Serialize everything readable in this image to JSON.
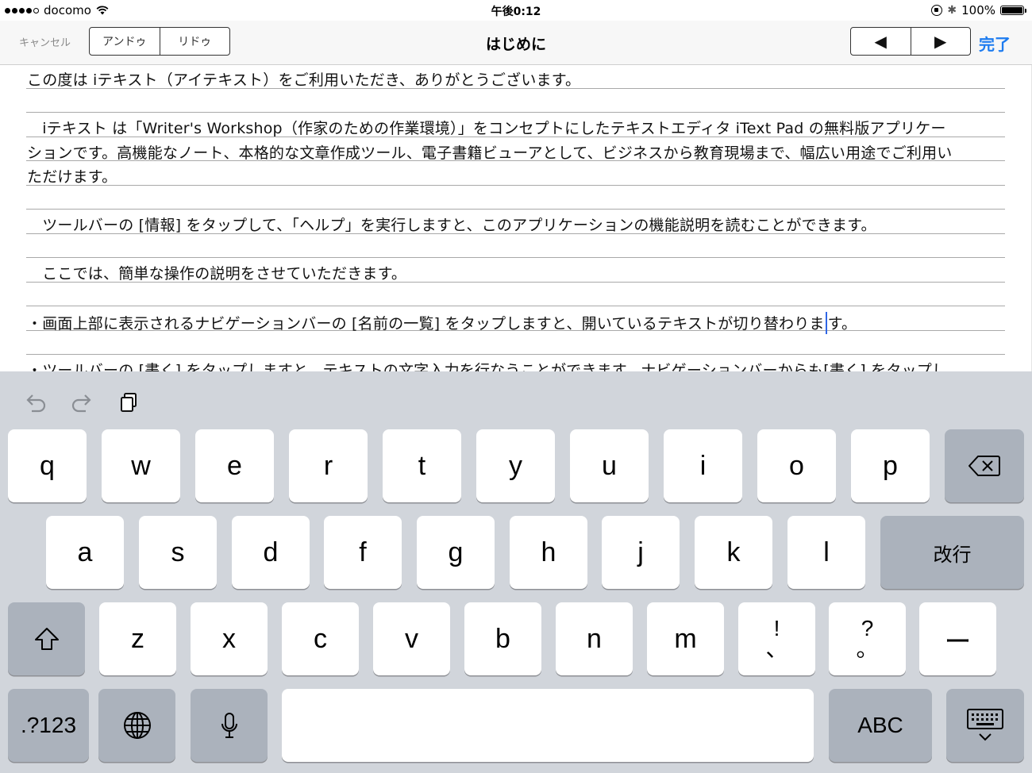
{
  "status": {
    "carrier": "docomo",
    "time": "午後0:12",
    "battery": "100%"
  },
  "nav": {
    "cancel": "キャンセル",
    "undo": "アンドゥ",
    "redo": "リドゥ",
    "title": "はじめに",
    "prev": "◀",
    "next": "▶",
    "done": "完了"
  },
  "editor": {
    "line1": "この度は iテキスト（アイテキスト）をご利用いただき、ありがとうございます。",
    "line2": "　iテキスト は「Writer's Workshop（作家のための作業環境）」をコンセプトにしたテキストエディタ iText Pad の無料版アプリケー",
    "line3": "ションです。高機能なノート、本格的な文章作成ツール、電子書籍ビューアとして、ビジネスから教育現場まで、幅広い用途でご利用い",
    "line4": "ただけます。",
    "line5": "　ツールバーの [情報] をタップして、「ヘルプ」を実行しますと、このアプリケーションの機能説明を読むことができます。",
    "line6": "　ここでは、簡単な操作の説明をさせていただきます。",
    "line7_before": "・画面上部に表示されるナビゲーションバーの [名前の一覧] をタップしますと、開いているテキストが切り替わりま",
    "line7_after": "す。",
    "line8": "・ツールバーの [書く] をタップしますと、テキストの文字入力を行なうことができます。ナビゲーションバーからも[書く] をタップし"
  },
  "keyboard": {
    "row1": [
      "q",
      "w",
      "e",
      "r",
      "t",
      "y",
      "u",
      "i",
      "o",
      "p"
    ],
    "row2": [
      "a",
      "s",
      "d",
      "f",
      "g",
      "h",
      "j",
      "k",
      "l"
    ],
    "row3": [
      "z",
      "x",
      "c",
      "v",
      "b",
      "n",
      "m"
    ],
    "return": "改行",
    "excl": "!",
    "comma": "、",
    "question": "?",
    "period": "。",
    "dash": "ー",
    "numbers": ".?123",
    "abc": "ABC"
  }
}
